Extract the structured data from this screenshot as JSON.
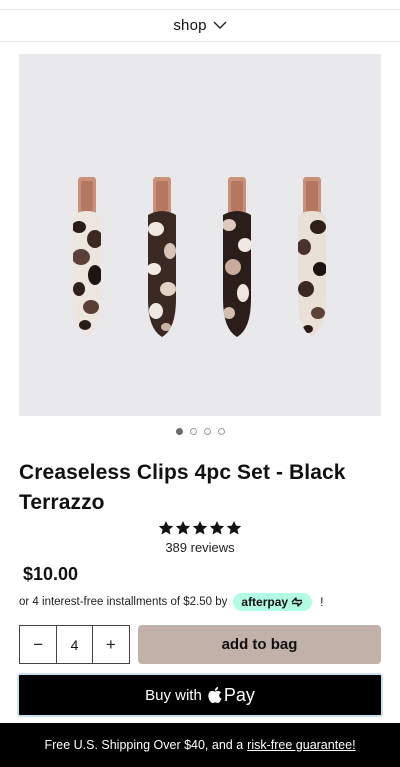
{
  "header": {
    "shop_label": "shop",
    "chevron_icon": "chevron-down-icon"
  },
  "gallery": {
    "image_count": 4,
    "active_index": 0
  },
  "product": {
    "title": "Creaseless Clips 4pc Set - Black Terrazzo",
    "rating": 5,
    "reviews_label": "389 reviews",
    "price": "$10.00"
  },
  "installments": {
    "text": "or 4 interest-free installments of $2.50 by",
    "provider": "afterpay",
    "provider_color": "#b2fce4",
    "info": "!"
  },
  "purchase": {
    "quantity": "4",
    "minus": "−",
    "plus": "+",
    "add_label": "add to bag",
    "add_color": "#c2b1a8",
    "applepay_prefix": "Buy with",
    "applepay_word": "Pay"
  },
  "footer": {
    "text": "Free U.S. Shipping Over $40, and a",
    "link": "risk-free guarantee!"
  }
}
